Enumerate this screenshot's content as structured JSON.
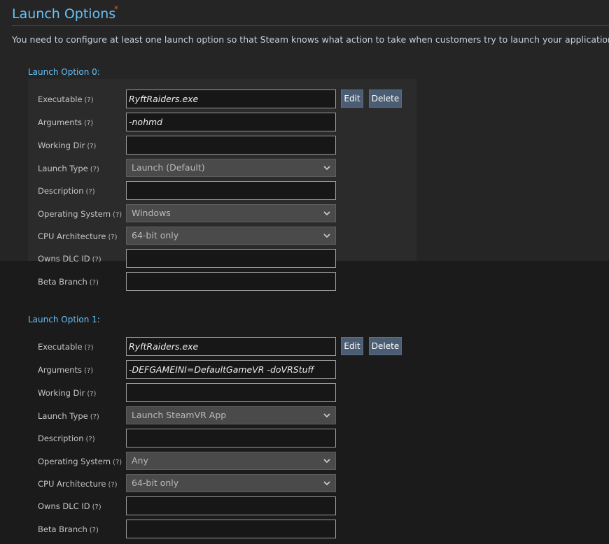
{
  "header": {
    "title": "Launch Options",
    "required_marker": "*",
    "description": "You need to configure at least one launch option so that Steam knows what action to take when customers try to launch your application."
  },
  "labels": {
    "executable": "Executable",
    "arguments": "Arguments",
    "working_dir": "Working Dir",
    "launch_type": "Launch Type",
    "description": "Description",
    "operating_system": "Operating System",
    "cpu_architecture": "CPU Architecture",
    "owns_dlc_id": "Owns DLC ID",
    "beta_branch": "Beta Branch",
    "help": "(?)"
  },
  "buttons": {
    "edit": "Edit",
    "delete": "Delete"
  },
  "options": [
    {
      "heading": "Launch Option 0:",
      "executable": "RyftRaiders.exe",
      "arguments": "-nohmd",
      "working_dir": "",
      "launch_type": "Launch (Default)",
      "description": "",
      "operating_system": "Windows",
      "cpu_architecture": "64-bit only",
      "owns_dlc_id": "",
      "beta_branch": ""
    },
    {
      "heading": "Launch Option 1:",
      "executable": "RyftRaiders.exe",
      "arguments": "-DEFGAMEINI=DefaultGameVR -doVRStuff",
      "working_dir": "",
      "launch_type": "Launch SteamVR App",
      "description": "",
      "operating_system": "Any",
      "cpu_architecture": "64-bit only",
      "owns_dlc_id": "",
      "beta_branch": ""
    }
  ],
  "colors": {
    "accent": "#67c1f5",
    "required": "#e0532e",
    "button": "#4b5d72",
    "background": "#1b1b1b"
  }
}
